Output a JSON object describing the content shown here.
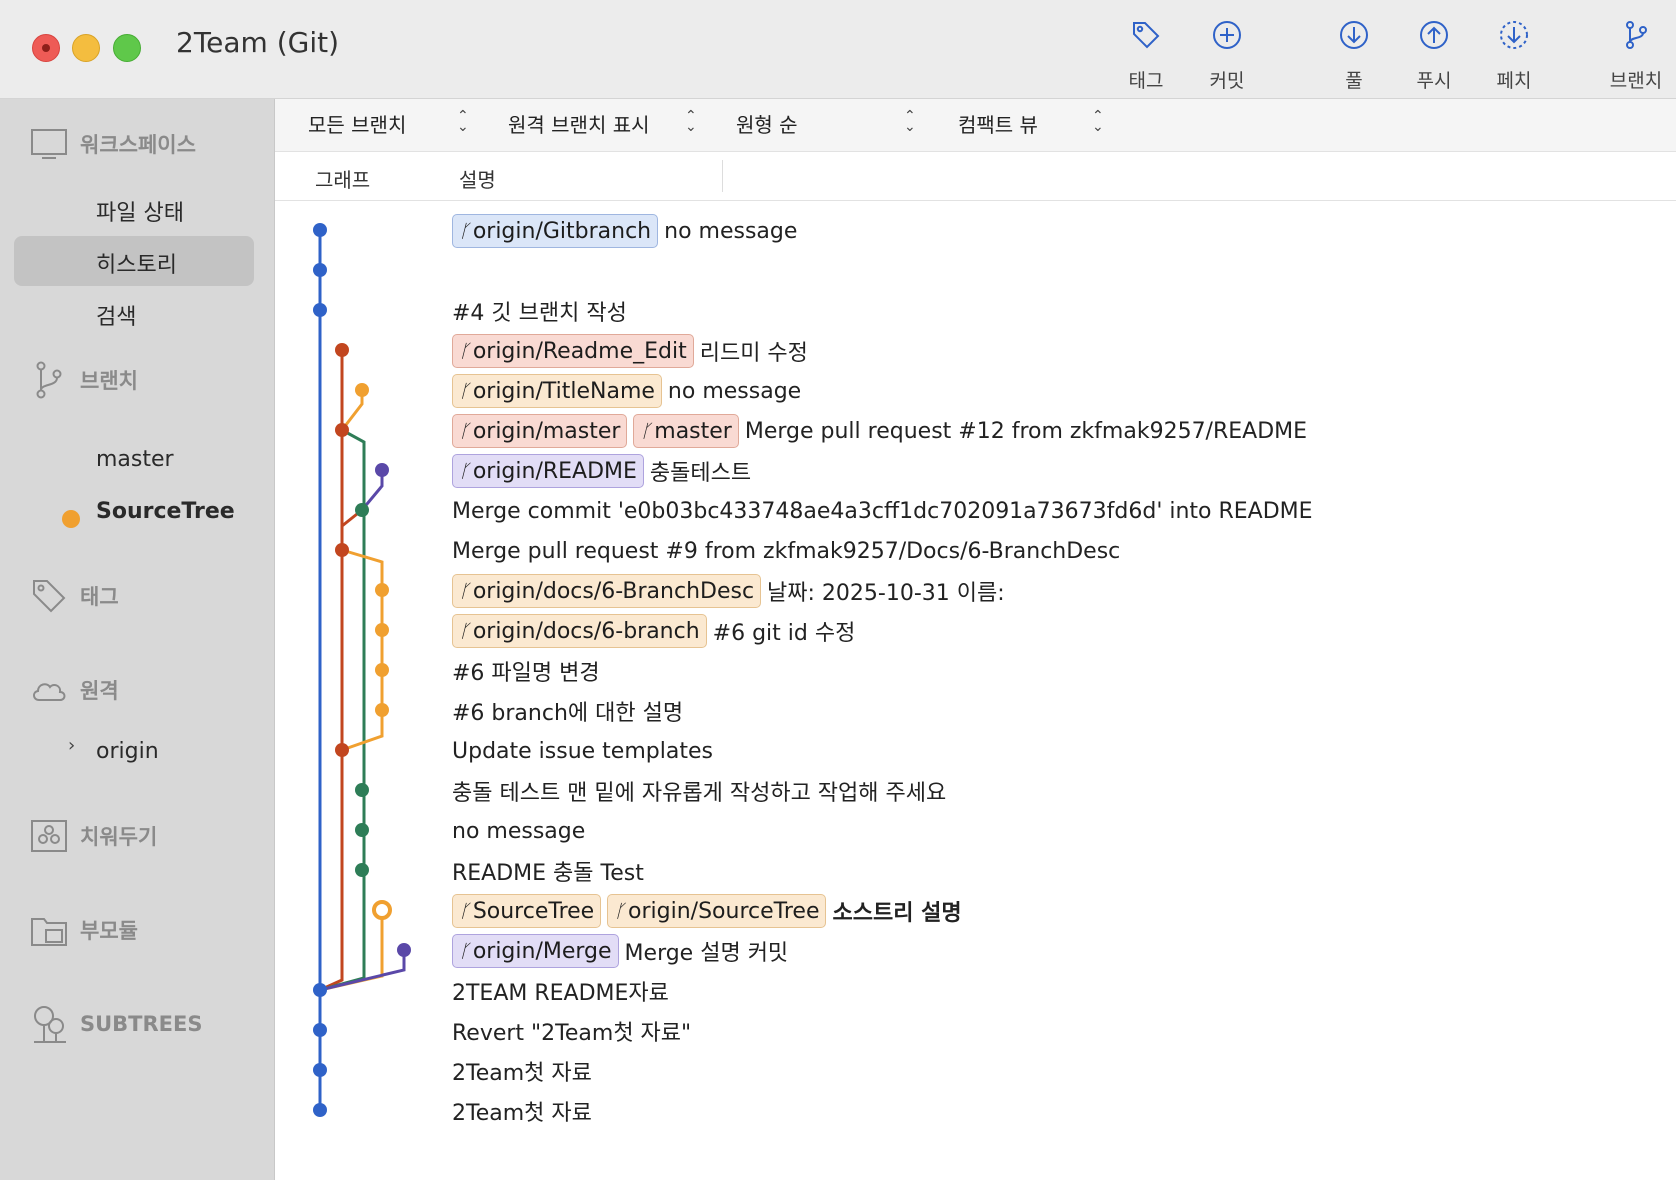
{
  "window": {
    "title": "2Team (Git)"
  },
  "toolbar": {
    "buttons": [
      {
        "id": "tag",
        "label": "태그",
        "icon": "tag-icon"
      },
      {
        "id": "commit",
        "label": "커밋",
        "icon": "plus-circle-icon"
      },
      {
        "id": "pull",
        "label": "풀",
        "icon": "arrow-down-circle-icon"
      },
      {
        "id": "push",
        "label": "푸시",
        "icon": "arrow-up-circle-icon"
      },
      {
        "id": "fetch",
        "label": "페치",
        "icon": "dashed-arrow-down-circle-icon"
      },
      {
        "id": "branch",
        "label": "브랜치",
        "icon": "branch-icon"
      }
    ]
  },
  "sidebar": {
    "workspace": {
      "label": "워크스페이스",
      "items": [
        "파일 상태",
        "히스토리",
        "검색"
      ],
      "selected": "히스토리"
    },
    "branches": {
      "label": "브랜치",
      "items": [
        "master",
        "SourceTree"
      ],
      "current": "SourceTree"
    },
    "tags": {
      "label": "태그"
    },
    "remotes": {
      "label": "원격",
      "items": [
        "origin"
      ]
    },
    "stashes": {
      "label": "치워두기"
    },
    "submodules": {
      "label": "부모듈"
    },
    "subtrees": {
      "label": "SUBTREES"
    }
  },
  "filters": {
    "branches": "모든 브랜치",
    "remote": "원격 브랜치 표시",
    "order": "원형 순",
    "view": "컴팩트 뷰"
  },
  "columns": {
    "graph": "그래프",
    "description": "설명"
  },
  "colors": {
    "blue": "#2f62c8",
    "red": "#c2461f",
    "orange": "#f0a030",
    "green": "#2e7d57",
    "purple": "#5a48a8"
  },
  "commits": [
    {
      "refs": [
        {
          "name": "origin/Gitbranch",
          "color": "blue"
        }
      ],
      "message": "no message"
    },
    {
      "refs": [],
      "message": ""
    },
    {
      "refs": [],
      "message": "#4 깃 브랜치 작성"
    },
    {
      "refs": [
        {
          "name": "origin/Readme_Edit",
          "color": "red"
        }
      ],
      "message": "리드미 수정"
    },
    {
      "refs": [
        {
          "name": "origin/TitleName",
          "color": "orange"
        }
      ],
      "message": "no message"
    },
    {
      "refs": [
        {
          "name": "origin/master",
          "color": "red"
        },
        {
          "name": "master",
          "color": "red"
        }
      ],
      "message": "Merge pull request #12 from zkfmak9257/README"
    },
    {
      "refs": [
        {
          "name": "origin/README",
          "color": "purple"
        }
      ],
      "message": "충돌테스트"
    },
    {
      "refs": [],
      "message": "Merge commit 'e0b03bc433748ae4a3cff1dc702091a73673fd6d' into README"
    },
    {
      "refs": [],
      "message": "Merge pull request #9 from zkfmak9257/Docs/6-BranchDesc"
    },
    {
      "refs": [
        {
          "name": "origin/docs/6-BranchDesc",
          "color": "orange"
        }
      ],
      "message": "날짜: 2025-10-31 이름:"
    },
    {
      "refs": [
        {
          "name": "origin/docs/6-branch",
          "color": "orange"
        }
      ],
      "message": "#6 git id 수정"
    },
    {
      "refs": [],
      "message": "#6 파일명 변경"
    },
    {
      "refs": [],
      "message": "#6 branch에 대한 설명"
    },
    {
      "refs": [],
      "message": "Update issue templates"
    },
    {
      "refs": [],
      "message": "충돌 테스트 맨 밑에 자유롭게 작성하고 작업해 주세요"
    },
    {
      "refs": [],
      "message": "no message"
    },
    {
      "refs": [],
      "message": "README 충돌 Test"
    },
    {
      "refs": [
        {
          "name": "SourceTree",
          "color": "orange"
        },
        {
          "name": "origin/SourceTree",
          "color": "orange"
        }
      ],
      "message": "소스트리 설명",
      "bold": true
    },
    {
      "refs": [
        {
          "name": "origin/Merge",
          "color": "purple"
        }
      ],
      "message": "Merge 설명 커밋"
    },
    {
      "refs": [],
      "message": "2TEAM README자료"
    },
    {
      "refs": [],
      "message": "Revert \"2Team첫 자료\""
    },
    {
      "refs": [],
      "message": "2Team첫 자료"
    },
    {
      "refs": [],
      "message": "2Team첫 자료"
    }
  ]
}
